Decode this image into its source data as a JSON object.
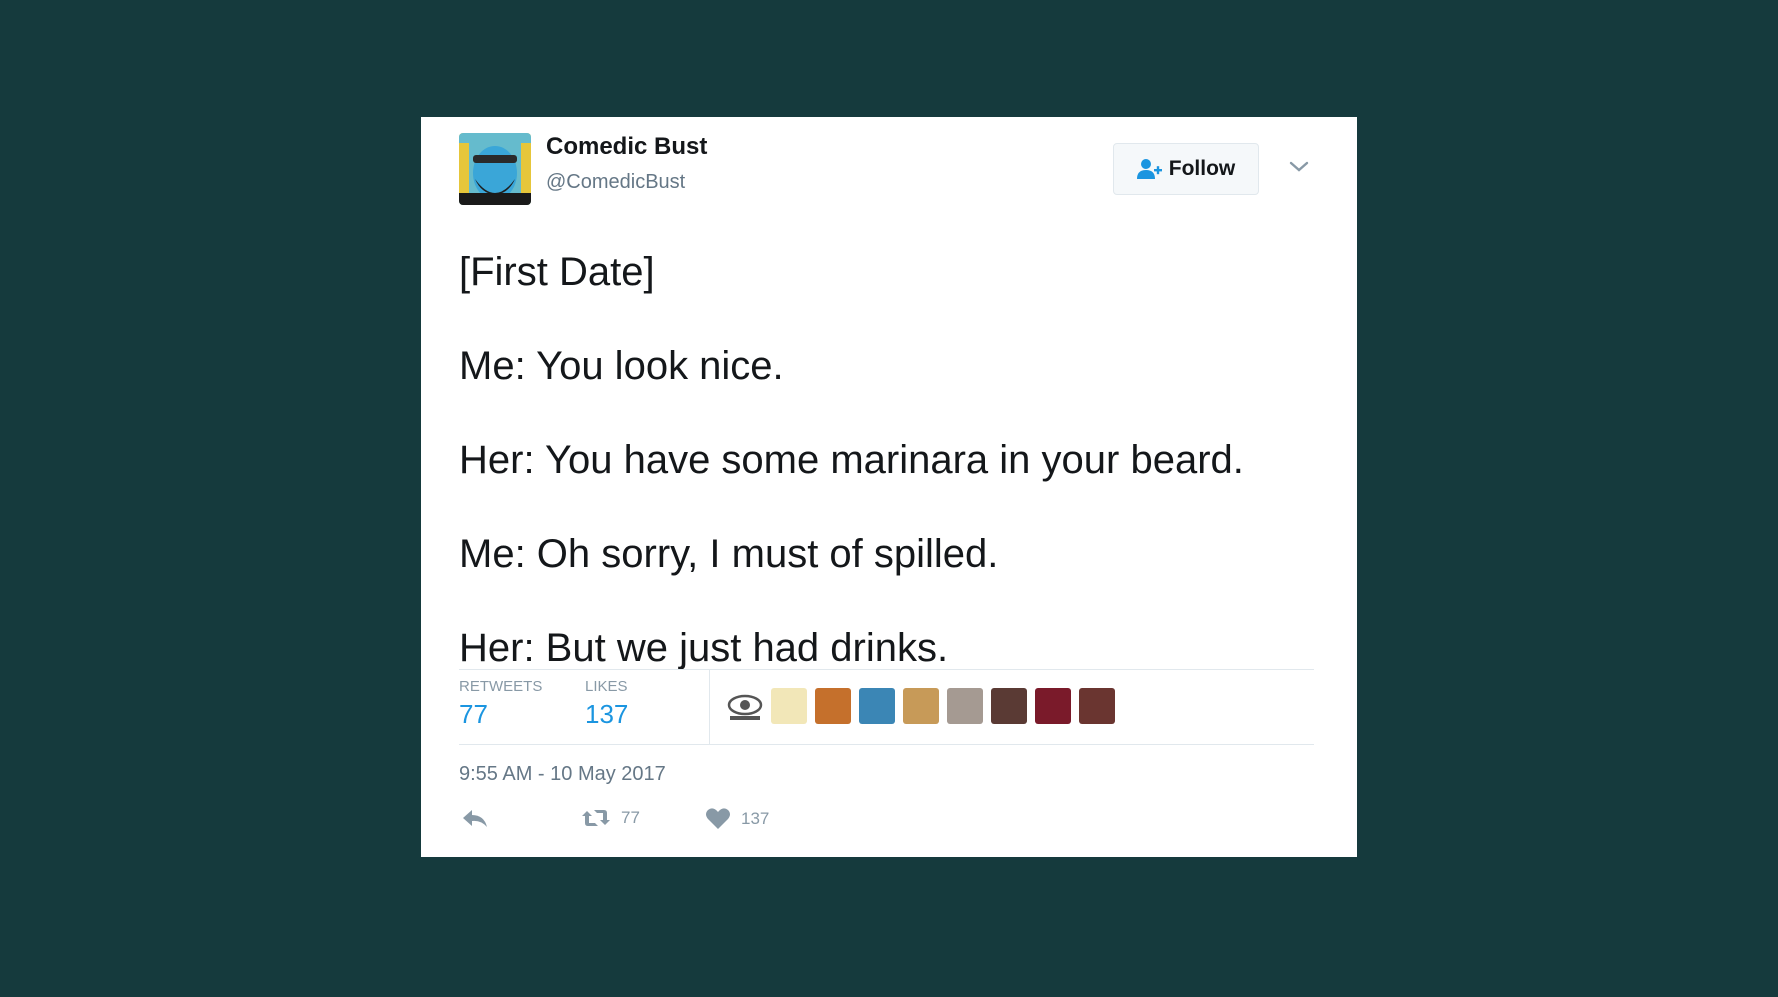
{
  "author": {
    "name": "Comedic Bust",
    "handle": "@ComedicBust",
    "avatar_icon": "bearded-man-avatar"
  },
  "follow_button": {
    "label": "Follow",
    "icon": "add-user-icon"
  },
  "menu_icon": "chevron-down-icon",
  "tweet": {
    "lines": [
      "[First Date]",
      "Me: You look nice.",
      "Her: You have some marinara in your beard.",
      "Me: Oh sorry, I must of spilled.",
      "Her: But we just had drinks."
    ]
  },
  "stats": {
    "retweets_label": "RETWEETS",
    "retweets_value": "77",
    "likes_label": "LIKES",
    "likes_value": "137"
  },
  "likers": [
    {
      "icon": "liker-avatar-1",
      "color": "#d8d8d8"
    },
    {
      "icon": "liker-avatar-2",
      "color": "#f2e7b8"
    },
    {
      "icon": "liker-avatar-3",
      "color": "#c5702c"
    },
    {
      "icon": "liker-avatar-4",
      "color": "#3b86b5"
    },
    {
      "icon": "liker-avatar-5",
      "color": "#c79a58"
    },
    {
      "icon": "liker-avatar-6",
      "color": "#a59a92"
    },
    {
      "icon": "liker-avatar-7",
      "color": "#5a3a34"
    },
    {
      "icon": "liker-avatar-8",
      "color": "#7a1a2a"
    },
    {
      "icon": "liker-avatar-9",
      "color": "#6a3530"
    }
  ],
  "timestamp": "9:55 AM - 10 May 2017",
  "actions": {
    "reply_icon": "reply-icon",
    "retweet_icon": "retweet-icon",
    "retweet_count": "77",
    "like_icon": "heart-icon",
    "like_count": "137"
  },
  "colors": {
    "background": "#153a3d",
    "accent": "#1b95e0",
    "text": "#14171a",
    "muted": "#657786"
  }
}
